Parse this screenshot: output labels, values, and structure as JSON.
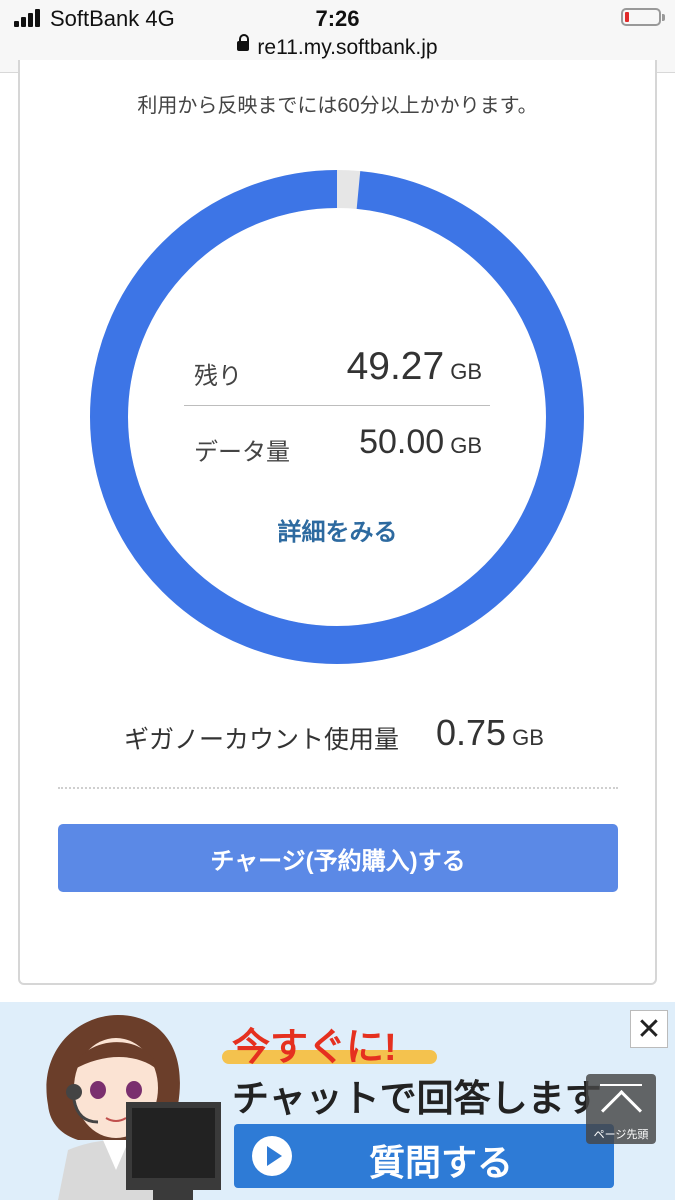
{
  "status_bar": {
    "carrier": "SoftBank   4G",
    "time": "7:26",
    "url": "re11.my.softbank.jp",
    "battery_level": 0.1
  },
  "usage": {
    "note": "利用から反映までには60分以上かかります。",
    "remaining_label": "残り",
    "remaining_value": "49.27",
    "remaining_unit": "GB",
    "total_label": "データ量",
    "total_value": "50.00",
    "total_unit": "GB",
    "remaining_fraction": 0.985,
    "detail_link": "詳細をみる",
    "ring_color": "#3d75e6",
    "ring_track_color": "#e6e6e6"
  },
  "giga": {
    "label": "ギガノーカウント使用量",
    "value": "0.75",
    "unit": "GB"
  },
  "charge_button": "チャージ(予約購入)する",
  "ad": {
    "headline1": "今すぐに!",
    "headline2": "チャットで回答します",
    "cta": "質問する",
    "close_symbol": "✕",
    "page_top_label": "ページ先頭"
  }
}
